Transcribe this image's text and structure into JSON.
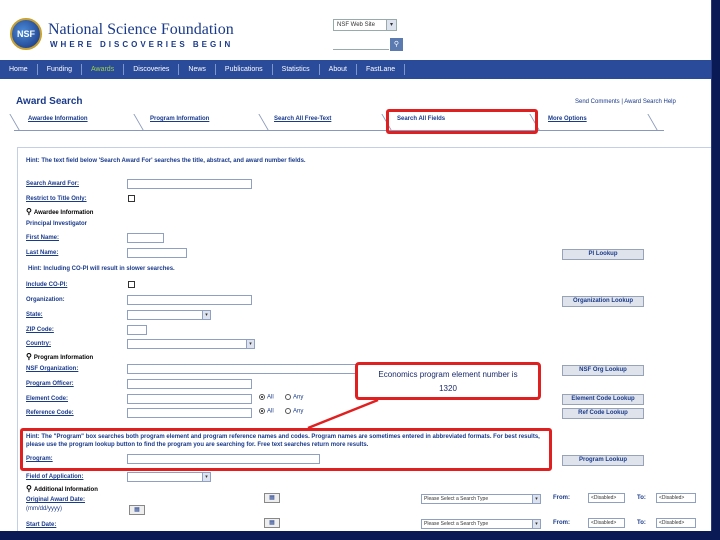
{
  "header": {
    "logo_text": "NSF",
    "org_name": "National Science Foundation",
    "tagline": "WHERE DISCOVERIES BEGIN",
    "search_scope": "NSF Web Site",
    "search_button": "Q"
  },
  "nav": {
    "items": [
      "Home",
      "Funding",
      "Awards",
      "Discoveries",
      "News",
      "Publications",
      "Statistics",
      "About",
      "FastLane"
    ],
    "active": "Awards"
  },
  "page": {
    "title": "Award Search",
    "help_links": "Send Comments | Award Search Help"
  },
  "tabs": [
    "Awardee Information",
    "Program Information",
    "Search All Free-Text",
    "Search All Fields",
    "More Options"
  ],
  "form": {
    "hint_main": "Hint: The text field below 'Search Award For' searches the title, abstract, and award number fields.",
    "search_award_for": "Search Award For:",
    "restrict_title": "Restrict to Title Only:",
    "awardee_section": "Awardee Information",
    "principal_investigator": "Principal Investigator",
    "first_name": "First Name:",
    "last_name": "Last Name:",
    "pi_lookup": "PI Lookup",
    "hint_copi": "Hint: Including CO-PI will result in slower searches.",
    "include_copi": "Include CO-PI:",
    "organization": "Organization:",
    "org_lookup": "Organization Lookup",
    "state": "State:",
    "zip": "ZIP Code:",
    "country": "Country:",
    "program_section": "Program Information",
    "nsf_org": "NSF Organization:",
    "nsf_org_lookup": "NSF Org Lookup",
    "program_officer": "Program Officer:",
    "element_code": "Element Code:",
    "element_code_lookup": "Element Code Lookup",
    "reference_code": "Reference Code:",
    "ref_code_lookup": "Ref Code Lookup",
    "radio_all": "All",
    "radio_any": "Any",
    "hint_program": "Hint: The \"Program\" box searches both program element and program reference names and codes. Program names are sometimes entered in abbreviated formats. For best results, please use the program lookup button to find the program you are searching for. Free text searches return more results.",
    "program": "Program:",
    "program_lookup": "Program Lookup",
    "field_of_application": "Field of Application:",
    "additional_section": "Additional Information",
    "original_award_date": "Original Award Date:",
    "date_format": "(mm/dd/yyyy)",
    "start_date": "Start Date:",
    "search_type_placeholder": "Please Select a Search Type",
    "from": "From:",
    "to": "To:",
    "disabled_text": "<Disabled>"
  },
  "callout": {
    "line1": "Economics program element number is",
    "line2": "1320"
  },
  "colors": {
    "frame_bg": "#0a1a55",
    "nav_bg": "#2a4a9a",
    "nav_active": "#9ad04a",
    "annotation_red": "#e02020",
    "text_blue": "#1a3a8a"
  }
}
